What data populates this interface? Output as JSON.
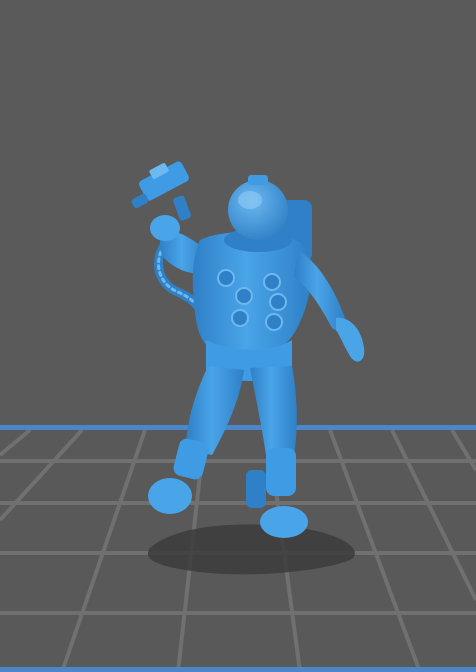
{
  "viewport": {
    "background_color": "#5a5a5a",
    "floor_color": "#595959",
    "grid_line_color": "#6e6e6e",
    "build_plate_edge_color": "#4a86c8",
    "model_color": "#3f9be3",
    "model_shade_color": "#2f80c6",
    "model_highlight_color": "#6cb8f0",
    "shadow_color": "#3c3c3c"
  },
  "model": {
    "subject": "astronaut-figure-with-blaster",
    "icon": "astronaut-icon"
  }
}
